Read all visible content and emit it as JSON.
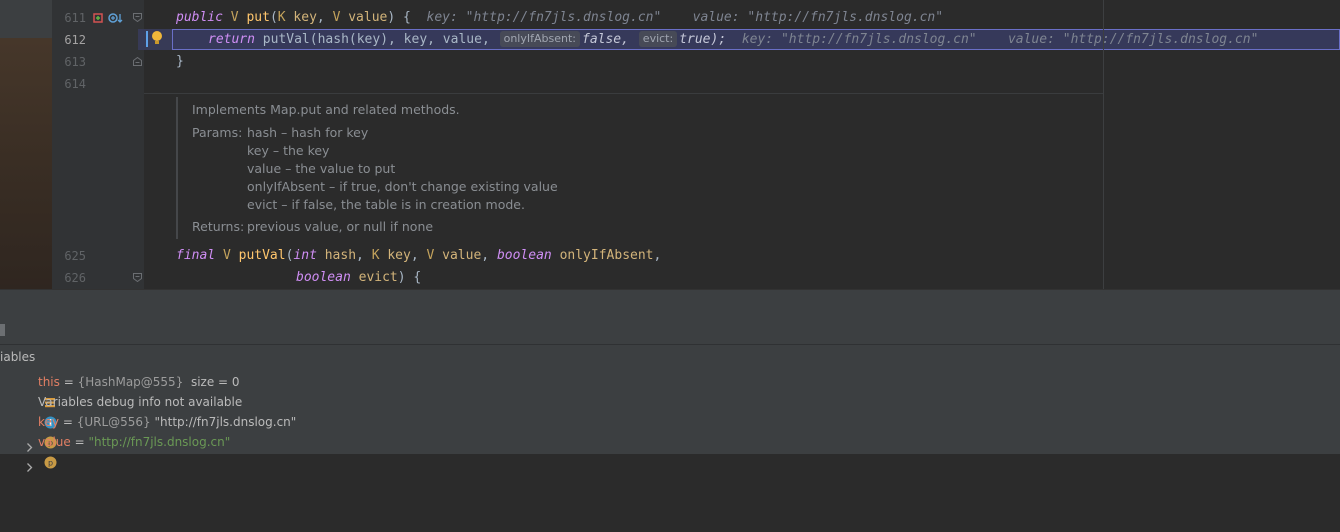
{
  "editor": {
    "line_numbers": [
      "611",
      "612",
      "613",
      "614",
      "625",
      "626"
    ],
    "line_611": {
      "kw_public": "public",
      "type_v": "V",
      "fn_put": "put",
      "open": "(",
      "type_k": "K",
      "p_key": "key",
      "comma1": ", ",
      "type_v2": "V",
      "p_value": "value",
      "close": ") {",
      "hint_key": "key: \"http://fn7jls.dnslog.cn\"",
      "hint_value": "value: \"http://fn7jls.dnslog.cn\""
    },
    "line_612": {
      "kw_return": "return",
      "call": "putVal(hash(key), key, value,",
      "inlay_onlyifabsent": "onlyIfAbsent:",
      "val_false": "false,",
      "inlay_evict": "evict:",
      "val_true": "true);",
      "hint_key": "key: \"http://fn7jls.dnslog.cn\"",
      "hint_value": "value: \"http://fn7jls.dnslog.cn\""
    },
    "line_613": {
      "text": "}"
    },
    "doc": {
      "summary": "Implements Map.put and related methods.",
      "params_label": "Params:",
      "params": [
        "hash – hash for key",
        "key – the key",
        "value – the value to put",
        "onlyIfAbsent – if true, don't change existing value",
        "evict – if false, the table is in creation mode."
      ],
      "returns_label": "Returns:",
      "returns": "previous value, or null if none"
    },
    "line_625": {
      "kw_final": "final",
      "type_v": "V",
      "fn": "putVal",
      "open": "(",
      "kw_int": "int",
      "p_hash": "hash",
      "type_k": "K",
      "p_key": "key",
      "type_v2": "V",
      "p_value": "value",
      "kw_boolean": "boolean",
      "p_onlyifabsent": "onlyIfAbsent",
      "trail": ","
    },
    "line_626": {
      "kw_boolean": "boolean",
      "p_evict": "evict",
      "close": ") {"
    }
  },
  "debugger": {
    "panel_title": "iables",
    "variables": [
      {
        "name": "this",
        "type": "{HashMap@555}",
        "value": "size = 0",
        "icon": "field-icon",
        "expandable": false
      },
      {
        "name": "",
        "type": "",
        "value": "Variables debug info not available",
        "icon": "info-icon",
        "expandable": false
      },
      {
        "name": "key",
        "type": "{URL@556}",
        "value": "\"http://fn7jls.dnslog.cn\"",
        "icon": "param-icon",
        "expandable": true
      },
      {
        "name": "value",
        "type": "",
        "value": "\"http://fn7jls.dnslog.cn\"",
        "icon": "param-icon",
        "expandable": true
      }
    ]
  },
  "colors": {
    "editor_bg": "#2b2b2b",
    "gutter_bg": "#313335",
    "current_line": "#36395a",
    "panel_bg": "#3c3f41"
  }
}
